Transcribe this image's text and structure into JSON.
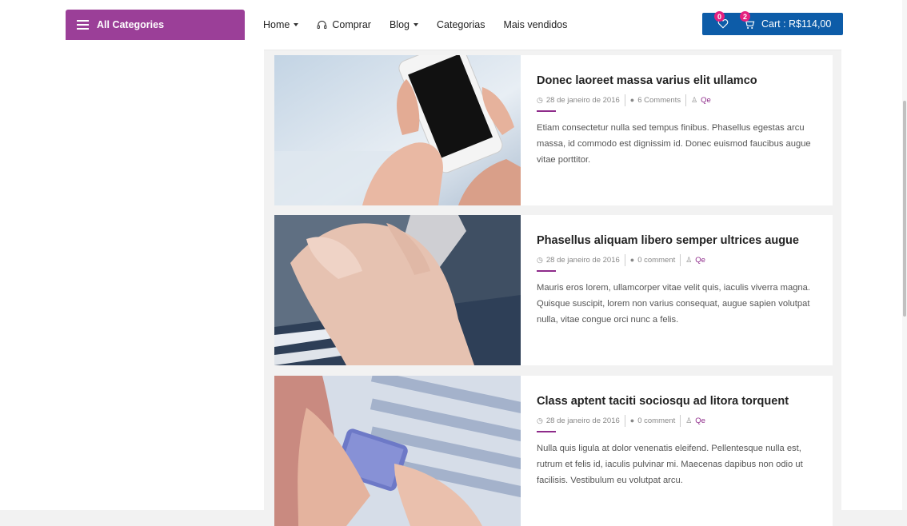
{
  "header": {
    "all_categories": "All Categories",
    "nav": [
      {
        "label": "Home",
        "dropdown": true
      },
      {
        "label": "Comprar",
        "icon": "headset-icon"
      },
      {
        "label": "Blog",
        "dropdown": true
      },
      {
        "label": "Categorias"
      },
      {
        "label": "Mais vendidos"
      }
    ],
    "wishlist_count": "0",
    "cart_count": "2",
    "cart_text": "Cart : R$114,00",
    "cart_color": "#0d5ca8",
    "category_color": "#9b3f98"
  },
  "posts": [
    {
      "title": "Donec laoreet massa varius elit ullamco",
      "date": "28 de janeiro de 2016",
      "comments": "6 Comments",
      "author": "Qe",
      "excerpt": "Etiam consectetur nulla sed tempus finibus. Phasellus egestas arcu massa, id commodo est dignissim id. Donec euismod faucibus augue vitae porttitor."
    },
    {
      "title": "Phasellus aliquam libero semper ultrices augue",
      "date": "28 de janeiro de 2016",
      "comments": "0 comment",
      "author": "Qe",
      "excerpt": "Mauris eros lorem, ullamcorper vitae velit quis, iaculis viverra magna. Quisque suscipit, lorem non varius consequat, augue sapien volutpat nulla, vitae congue orci nunc a felis."
    },
    {
      "title": "Class aptent taciti sociosqu ad litora torquent",
      "date": "28 de janeiro de 2016",
      "comments": "0 comment",
      "author": "Qe",
      "excerpt": "Nulla quis ligula at dolor venenatis eleifend. Pellentesque nulla est, rutrum et felis id, iaculis pulvinar mi. Maecenas dapibus non odio ut facilisis. Vestibulum eu volutpat arcu."
    }
  ]
}
